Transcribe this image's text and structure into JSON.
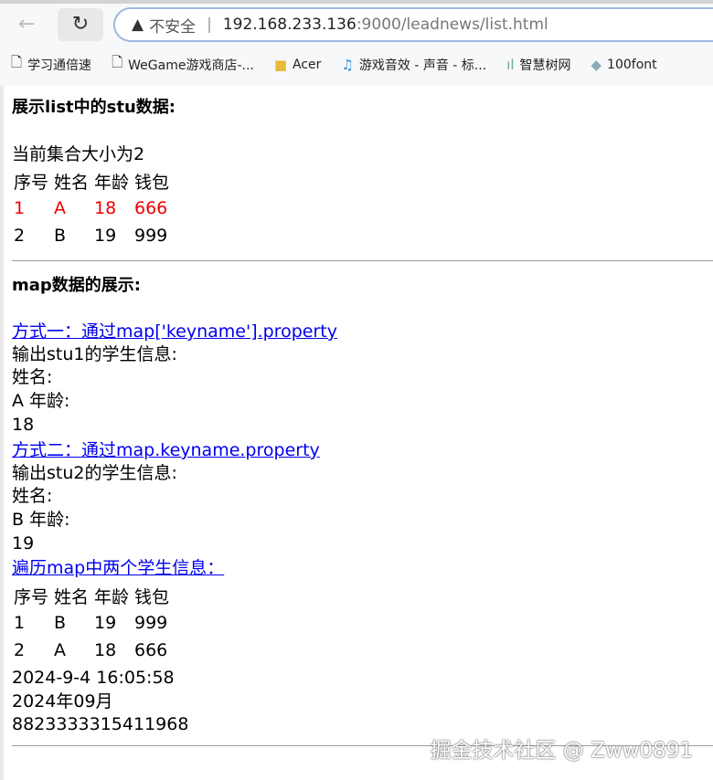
{
  "browser": {
    "address_insecure": "不安全",
    "address_host": "192.168.233.136",
    "address_path": ":9000/leadnews/list.html",
    "bookmarks": [
      {
        "label": "学习通倍速",
        "icon": "page-icon"
      },
      {
        "label": "WeGame游戏商店-...",
        "icon": "page-icon"
      },
      {
        "label": "Acer",
        "icon": "folder-icon"
      },
      {
        "label": "游戏音效 - 声音 - 标...",
        "icon": "site-icon"
      },
      {
        "label": "智慧树网",
        "icon": "site-icon"
      },
      {
        "label": "100font",
        "icon": "site-icon"
      }
    ]
  },
  "list_section": {
    "title": "展示list中的stu数据:",
    "size_text": "当前集合大小为2",
    "headers": [
      "序号",
      "姓名",
      "年龄",
      "钱包"
    ],
    "rows": [
      [
        "1",
        "A",
        "18",
        "666"
      ],
      [
        "2",
        "B",
        "19",
        "999"
      ]
    ],
    "highlight_color": "#ee0000"
  },
  "map_section": {
    "title": "map数据的展示:",
    "method1_link": "方式一：通过map['keyname'].property",
    "stu1_label": "输出stu1的学生信息:",
    "stu1_name_label": "姓名:",
    "stu1_name_age": "A 年龄:",
    "stu1_age": "18",
    "method2_link": "方式二：通过map.keyname.property",
    "stu2_label": "输出stu2的学生信息:",
    "stu2_name_label": "姓名:",
    "stu2_name_age": "B 年龄:",
    "stu2_age": "19",
    "iterate_link": "遍历map中两个学生信息：",
    "headers": [
      "序号",
      "姓名",
      "年龄",
      "钱包"
    ],
    "rows": [
      [
        "1",
        "B",
        "19",
        "999"
      ],
      [
        "2",
        "A",
        "18",
        "666"
      ]
    ],
    "date1": "2024-9-4 16:05:58",
    "date2": "2024年09月",
    "number": "8823333315411968"
  },
  "watermark": "掘金技术社区 @ Zww0891"
}
